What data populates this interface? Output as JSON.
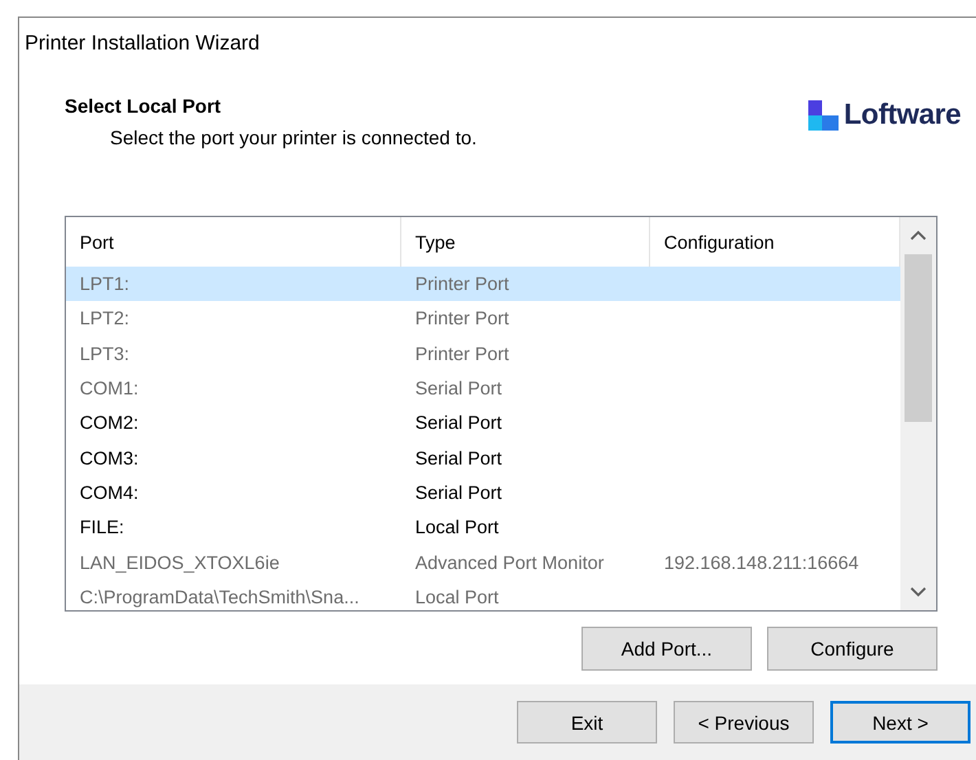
{
  "window": {
    "title": "Printer Installation Wizard"
  },
  "header": {
    "title": "Select Local Port",
    "subtitle": "Select the port your printer is connected to.",
    "logo_text": "Loftware"
  },
  "table": {
    "columns": [
      "Port",
      "Type",
      "Configuration"
    ],
    "rows": [
      {
        "port": "LPT1:",
        "type": "Printer Port",
        "selected": true,
        "disabled": true
      },
      {
        "port": "LPT2:",
        "type": "Printer Port",
        "selected": false,
        "disabled": true
      },
      {
        "port": "LPT3:",
        "type": "Printer Port",
        "selected": false,
        "disabled": true
      },
      {
        "port": "COM1:",
        "type": "Serial Port",
        "selected": false,
        "disabled": true
      },
      {
        "port": "COM2:",
        "type": "Serial Port",
        "selected": false,
        "disabled": false
      },
      {
        "port": "COM3:",
        "type": "Serial Port",
        "selected": false,
        "disabled": false
      },
      {
        "port": "COM4:",
        "type": "Serial Port",
        "selected": false,
        "disabled": false
      },
      {
        "port": "FILE:",
        "type": "Local Port",
        "selected": false,
        "disabled": false
      },
      {
        "port": "LAN_EIDOS_XTOXL6ie",
        "type": "Advanced Port Monitor",
        "configuration": "192.168.148.211:16664",
        "selected": false,
        "disabled": true
      },
      {
        "port": "C:\\ProgramData\\TechSmith\\Sna...",
        "type": "Local Port",
        "selected": false,
        "disabled": true
      }
    ]
  },
  "port_buttons": [
    "Add Port...",
    "Configure"
  ],
  "footer_buttons": [
    {
      "label": "Exit",
      "default": false
    },
    {
      "label": "< Previous",
      "default": false
    },
    {
      "label": "Next >",
      "default": true
    }
  ]
}
